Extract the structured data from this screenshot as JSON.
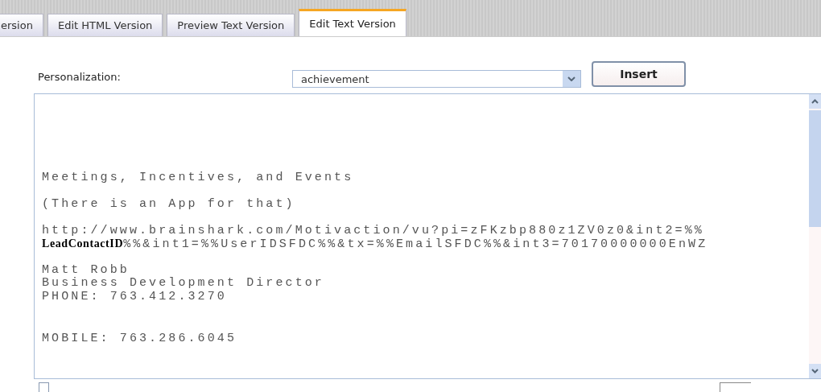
{
  "tabs": [
    {
      "label": "ersion",
      "selected": false
    },
    {
      "label": "Edit HTML Version",
      "selected": false
    },
    {
      "label": "Preview Text Version",
      "selected": false
    },
    {
      "label": "Edit Text Version",
      "selected": true
    }
  ],
  "personalization": {
    "label": "Personalization:",
    "value": "achievement",
    "button": "Insert"
  },
  "editor": {
    "paragraphs": [
      [
        "Meetings, Incentives, and Events"
      ],
      [
        "(There is an App for that)"
      ],
      [
        "http://www.brainshark.com/Motivaction/vu?pi=zFKzbp880z1ZV0z0&int2=%%",
        "**LeadContactID**%%&int1=%%UserIDSFDC%%&tx=%%EmailSFDC%%&int3=70170000000EnWZ"
      ],
      [
        "Matt Robb",
        "Business Development Director",
        "PHONE: 763.412.3270"
      ],
      [
        "MOBILE: 763.286.6045"
      ]
    ]
  },
  "footer": {
    "checkbox": {
      "checked": false
    }
  }
}
